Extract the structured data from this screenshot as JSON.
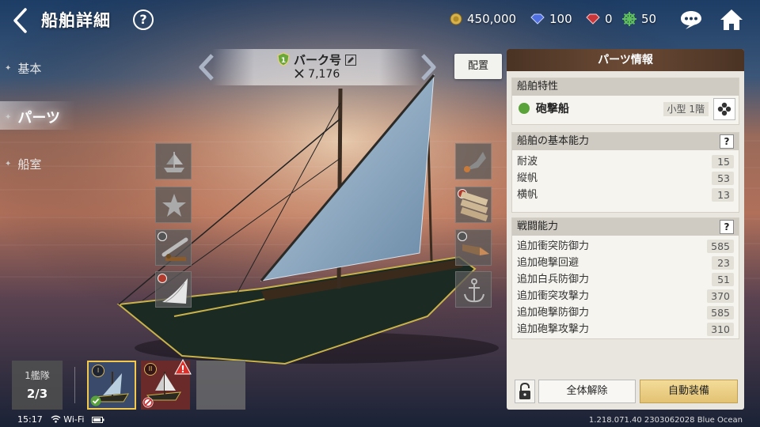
{
  "header": {
    "title": "船舶詳細",
    "help_label": "?",
    "currencies": [
      {
        "icon": "gold-coin-icon",
        "value": "450,000"
      },
      {
        "icon": "blue-gem-icon",
        "value": "100"
      },
      {
        "icon": "red-gem-icon",
        "value": "0"
      },
      {
        "icon": "ship-wheel-icon",
        "value": "50"
      }
    ]
  },
  "sidebar": {
    "items": [
      {
        "label": "基本",
        "active": false
      },
      {
        "label": "パーツ",
        "active": true
      },
      {
        "label": "船室",
        "active": false
      }
    ]
  },
  "ship": {
    "rank": "1",
    "name": "バーク号",
    "power": "7,176"
  },
  "deploy_label": "配置",
  "slots_left": [
    "hull-part-icon",
    "figurehead-star-icon",
    "cannon-part-icon",
    "sail-part-icon"
  ],
  "slots_right": [
    "ornament-part-icon",
    "plank-part-icon",
    "ram-part-icon",
    "anchor-icon"
  ],
  "fleet": {
    "label": "1艦隊",
    "count": "2/3",
    "ships": [
      {
        "roman": "I",
        "state": "selected"
      },
      {
        "roman": "II",
        "state": "warning"
      },
      {
        "roman": "",
        "state": "empty"
      }
    ]
  },
  "status_bar": {
    "time": "15:17",
    "wifi": "Wi-Fi",
    "version": "1.218.071.40 2303062028 Blue Ocean"
  },
  "panel": {
    "title": "パーツ情報",
    "traits": {
      "title": "船舶特性",
      "type": "砲撃船",
      "class": "小型 1階"
    },
    "basic": {
      "title": "船舶の基本能力",
      "help": "?",
      "rows": [
        {
          "label": "耐波",
          "value": "15"
        },
        {
          "label": "縦帆",
          "value": "53"
        },
        {
          "label": "横帆",
          "value": "13"
        }
      ]
    },
    "combat": {
      "title": "戦闘能力",
      "help": "?",
      "rows": [
        {
          "label": "追加衝突防御力",
          "value": "585"
        },
        {
          "label": "追加砲撃回避",
          "value": "23"
        },
        {
          "label": "追加白兵防御力",
          "value": "51"
        },
        {
          "label": "追加衝突攻撃力",
          "value": "370"
        },
        {
          "label": "追加砲撃防御力",
          "value": "585"
        },
        {
          "label": "追加砲撃攻撃力",
          "value": "310"
        }
      ]
    },
    "release_all": "全体解除",
    "auto_equip": "自動装備"
  },
  "colors": {
    "panel_header": "#5a3e2c",
    "auto_button": "#e8c97a",
    "selected_border": "#f2c94c",
    "warning": "#d9302b"
  }
}
